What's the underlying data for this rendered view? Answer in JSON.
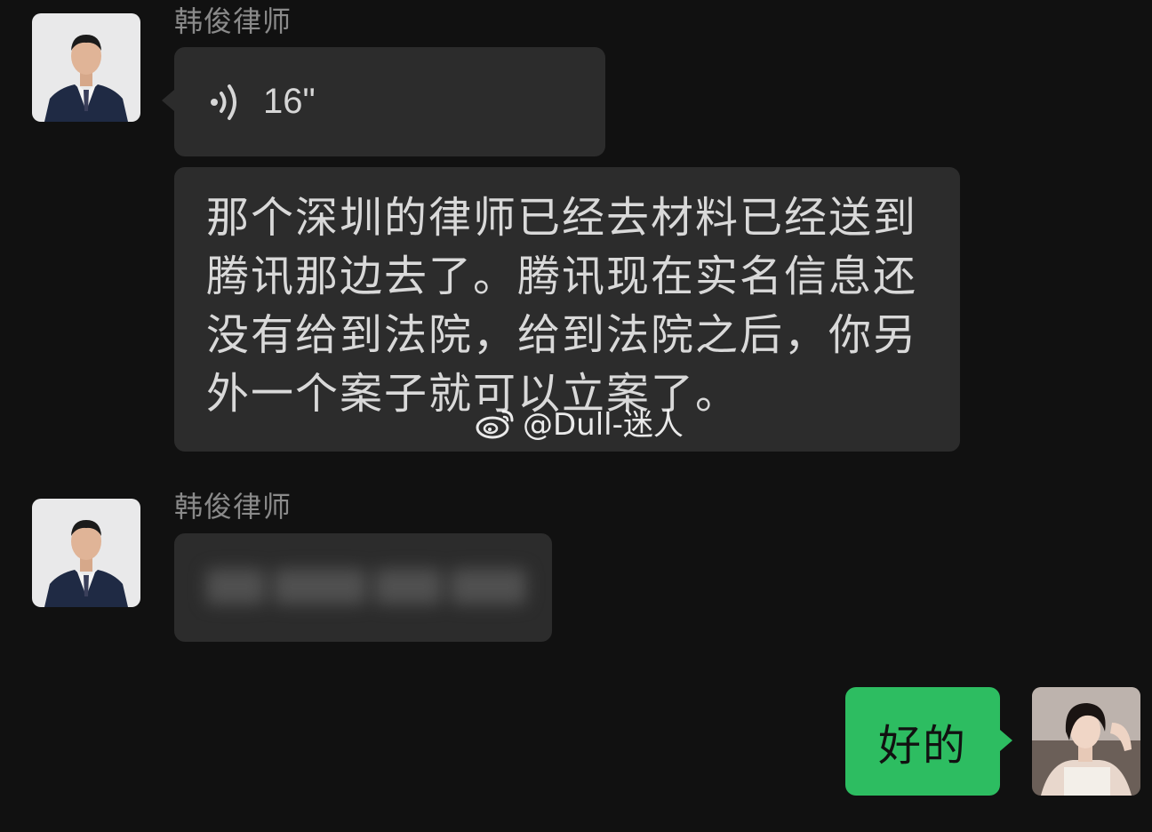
{
  "messages": [
    {
      "sender": "韩俊律师",
      "voice_duration": "16\"",
      "text": "那个深圳的律师已经去材料已经送到\n腾讯那边去了。腾讯现在实名信息还\n没有给到法院，给到法院之后，你另\n外一个案子就可以立案了。"
    },
    {
      "sender": "韩俊律师"
    }
  ],
  "reply": {
    "text": "好的"
  },
  "watermark": "@Dull-迷人",
  "colors": {
    "background": "#111111",
    "incoming_bubble": "#2c2c2c",
    "outgoing_bubble": "#2dbd61",
    "sender_name": "#8a8a8a"
  }
}
